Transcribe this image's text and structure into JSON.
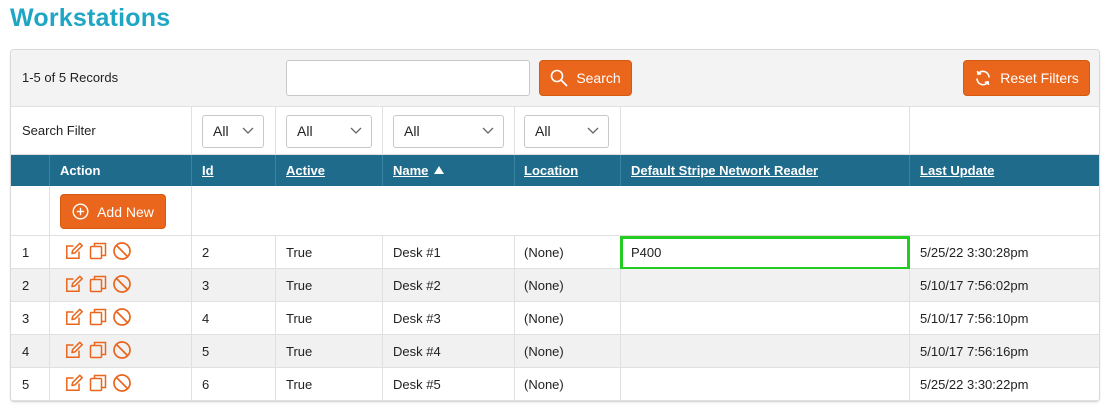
{
  "page": {
    "title": "Workstations"
  },
  "toolbar": {
    "records_text": "1-5 of 5 Records",
    "search_value": "",
    "search_label": "Search",
    "reset_label": "Reset Filters"
  },
  "filters": {
    "label": "Search Filter",
    "id": "All",
    "active": "All",
    "name": "All",
    "location": "All"
  },
  "table": {
    "headers": {
      "action": "Action",
      "id": "Id",
      "active": "Active",
      "name": "Name",
      "location": "Location",
      "reader": "Default Stripe Network Reader",
      "last_update": "Last Update"
    },
    "sort": {
      "column": "Name",
      "direction": "ascending"
    },
    "add_new_label": "Add New",
    "rows": [
      {
        "num": "1",
        "id": "2",
        "active": "True",
        "name": "Desk #1",
        "location": "(None)",
        "reader": "P400",
        "last_update": "5/25/22 3:30:28pm"
      },
      {
        "num": "2",
        "id": "3",
        "active": "True",
        "name": "Desk #2",
        "location": "(None)",
        "reader": "",
        "last_update": "5/10/17 7:56:02pm"
      },
      {
        "num": "3",
        "id": "4",
        "active": "True",
        "name": "Desk #3",
        "location": "(None)",
        "reader": "",
        "last_update": "5/10/17 7:56:10pm"
      },
      {
        "num": "4",
        "id": "5",
        "active": "True",
        "name": "Desk #4",
        "location": "(None)",
        "reader": "",
        "last_update": "5/10/17 7:56:16pm"
      },
      {
        "num": "5",
        "id": "6",
        "active": "True",
        "name": "Desk #5",
        "location": "(None)",
        "reader": "",
        "last_update": "5/25/22 3:30:22pm"
      }
    ],
    "row_icons": [
      "edit-icon",
      "copy-icon",
      "disable-icon"
    ]
  },
  "colors": {
    "title": "#1fa6c4",
    "header_bg": "#1e6b8c",
    "button_orange": "#e9661c",
    "highlight": "#22cc22"
  }
}
